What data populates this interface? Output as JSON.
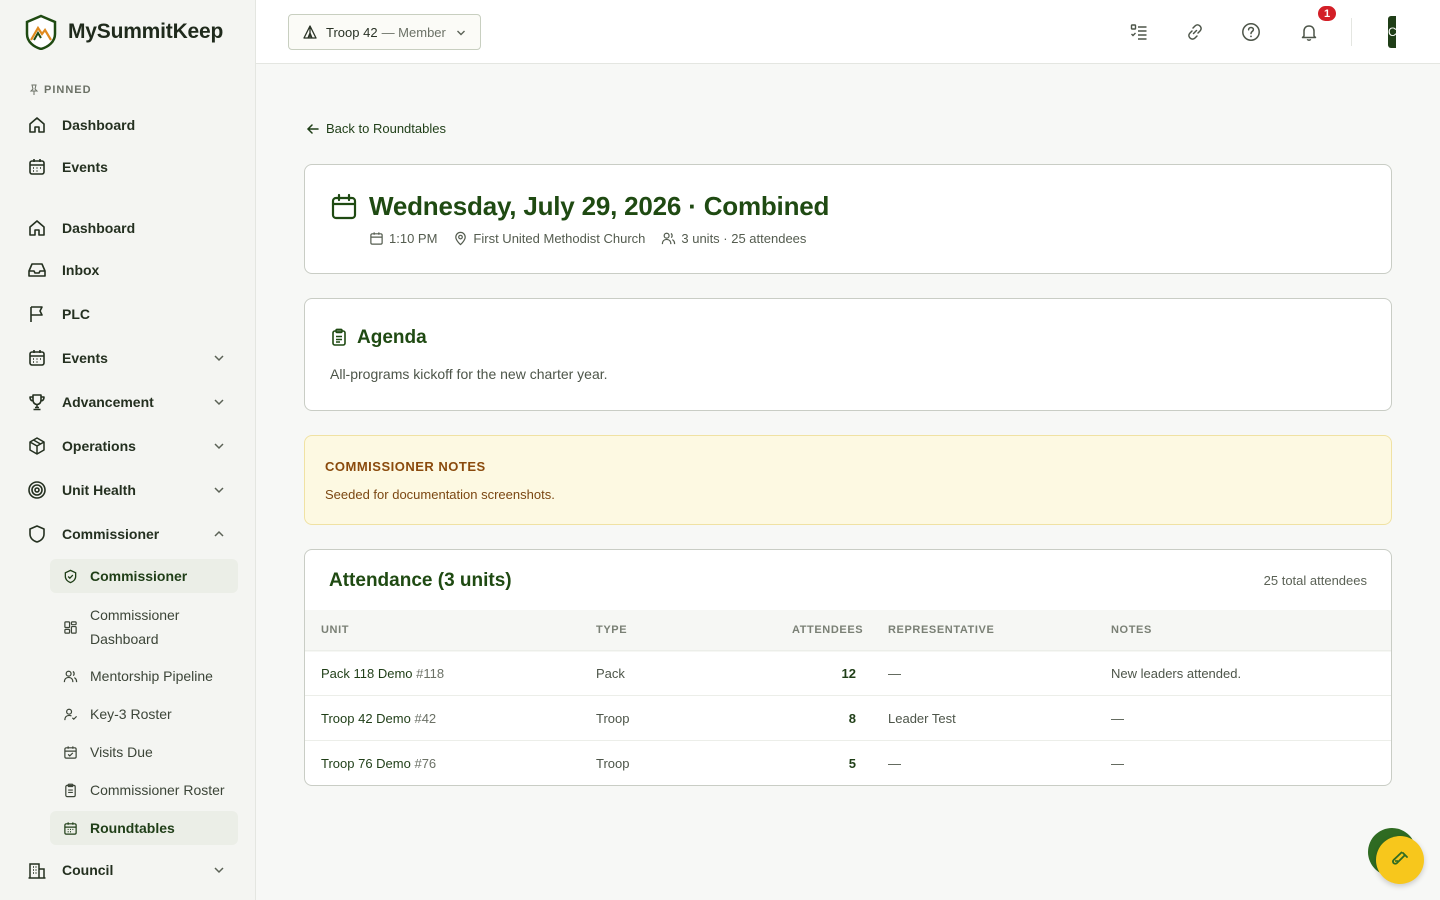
{
  "brand": {
    "name": "MySummitKeep"
  },
  "sidebar": {
    "pinned_label": "PINNED",
    "pinned": [
      {
        "label": "Dashboard",
        "icon": "home-icon"
      },
      {
        "label": "Events",
        "icon": "calendar-icon"
      }
    ],
    "items": [
      {
        "label": "Dashboard",
        "icon": "home-icon"
      },
      {
        "label": "Inbox",
        "icon": "inbox-icon"
      },
      {
        "label": "PLC",
        "icon": "flag-icon"
      },
      {
        "label": "Events",
        "icon": "calendar-icon",
        "expandable": true
      },
      {
        "label": "Advancement",
        "icon": "trophy-icon",
        "expandable": true
      },
      {
        "label": "Operations",
        "icon": "box-icon",
        "expandable": true
      },
      {
        "label": "Unit Health",
        "icon": "target-icon",
        "expandable": true
      },
      {
        "label": "Commissioner",
        "icon": "shield-icon",
        "expanded": true
      },
      {
        "label": "Council",
        "icon": "building-icon",
        "expandable": true
      }
    ],
    "commissioner_sub": [
      {
        "label": "Commissioner",
        "icon": "shield-check-icon",
        "active": true
      },
      {
        "label": "Commissioner Dashboard",
        "icon": "grid-icon"
      },
      {
        "label": "Mentorship Pipeline",
        "icon": "users-icon"
      },
      {
        "label": "Key-3 Roster",
        "icon": "user-check-icon"
      },
      {
        "label": "Visits Due",
        "icon": "calendar-check-icon"
      },
      {
        "label": "Commissioner Roster",
        "icon": "clipboard-icon"
      },
      {
        "label": "Roundtables",
        "icon": "calendar-grid-icon",
        "active": true
      }
    ]
  },
  "topbar": {
    "unit": "Troop 42",
    "role": "— Member",
    "notification_count": "1",
    "avatar_initial": "C"
  },
  "page": {
    "back_label": "Back to Roundtables",
    "title": "Wednesday, July 29, 2026 · Combined",
    "time": "1:10 PM",
    "location": "First United Methodist Church",
    "summary": "3 units · 25 attendees"
  },
  "agenda": {
    "title": "Agenda",
    "text": "All-programs kickoff for the new charter year."
  },
  "notes": {
    "title": "COMMISSIONER NOTES",
    "text": "Seeded for documentation screenshots."
  },
  "attendance": {
    "title": "Attendance (3 units)",
    "total": "25 total attendees",
    "columns": [
      "UNIT",
      "TYPE",
      "ATTENDEES",
      "REPRESENTATIVE",
      "NOTES"
    ],
    "rows": [
      {
        "unit": "Pack 118 Demo",
        "number": "#118",
        "type": "Pack",
        "attendees": "12",
        "representative": "—",
        "notes": "New leaders attended."
      },
      {
        "unit": "Troop 42 Demo",
        "number": "#42",
        "type": "Troop",
        "attendees": "8",
        "representative": "Leader Test",
        "notes": "—"
      },
      {
        "unit": "Troop 76 Demo",
        "number": "#76",
        "type": "Troop",
        "attendees": "5",
        "representative": "—",
        "notes": "—"
      }
    ]
  },
  "colors": {
    "brand_green": "#1f4a12",
    "accent_yellow": "#f7c71c",
    "badge_red": "#d31f27"
  }
}
